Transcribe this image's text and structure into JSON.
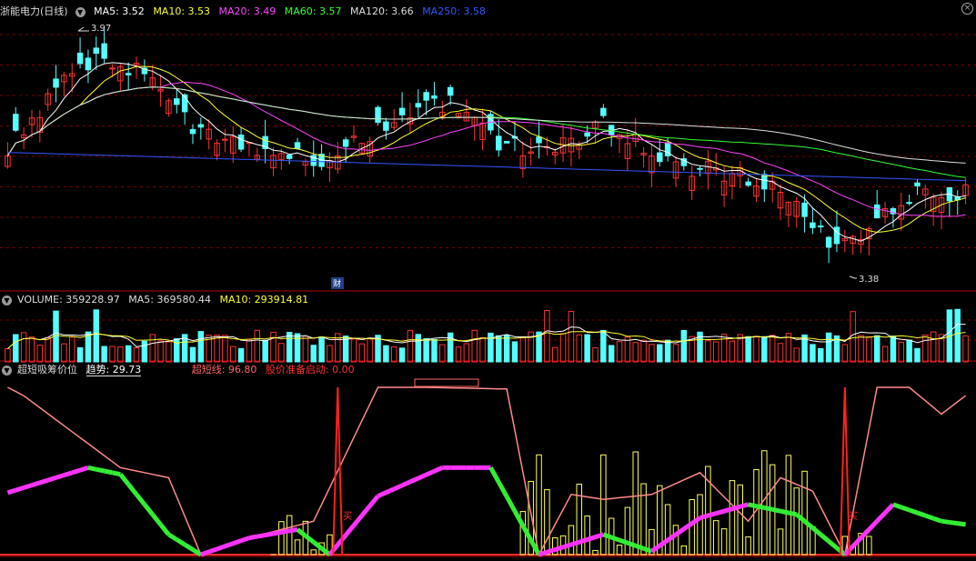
{
  "price_panel": {
    "stock_name": "浙能电力",
    "period": "(日线)",
    "ma_labels": [
      {
        "text": "MA5: 3.52",
        "color": "#ffffff"
      },
      {
        "text": "MA10: 3.53",
        "color": "#ffff33"
      },
      {
        "text": "MA20: 3.49",
        "color": "#ff44ff"
      },
      {
        "text": "MA60: 3.57",
        "color": "#33ff33"
      },
      {
        "text": "MA120: 3.66",
        "color": "#dddddd"
      },
      {
        "text": "MA250: 3.58",
        "color": "#3355ff"
      }
    ],
    "high_marker": "3.97",
    "low_marker": "3.38",
    "finance_badge": "财"
  },
  "volume_panel": {
    "title": "VOLUME: 359228.97",
    "ma5": "MA5: 369580.44",
    "ma10": "MA10: 293914.81"
  },
  "indicator_panel": {
    "name": "超短吸筹价位",
    "trend_label": "趋势: 29.73",
    "line_label": "超短线: 96.80",
    "alert_label": "股价准备启动: 0.00",
    "buy_labels": [
      "买",
      "买"
    ]
  },
  "colors": {
    "up": "#ff3232",
    "down": "#54ffff",
    "ma5": "#ffffff",
    "ma10": "#ffff33",
    "ma20": "#ff44ff",
    "ma60": "#33ff33",
    "ma120": "#dddddd",
    "ma250": "#3355ff",
    "grid": "#7a0000"
  },
  "chart_data": [
    {
      "type": "candlestick",
      "title": "浙能电力 (日线)",
      "price_markers": {
        "high": 3.97,
        "low": 3.38
      },
      "y_range": [
        3.3,
        4.05
      ],
      "bars": 120,
      "price_path_anchors": [
        [
          0,
          3.68
        ],
        [
          8,
          3.9
        ],
        [
          12,
          3.94
        ],
        [
          18,
          3.88
        ],
        [
          22,
          3.75
        ],
        [
          27,
          3.68
        ],
        [
          33,
          3.66
        ],
        [
          39,
          3.64
        ],
        [
          44,
          3.7
        ],
        [
          50,
          3.78
        ],
        [
          55,
          3.8
        ],
        [
          61,
          3.68
        ],
        [
          68,
          3.66
        ],
        [
          74,
          3.74
        ],
        [
          79,
          3.67
        ],
        [
          84,
          3.62
        ],
        [
          90,
          3.6
        ],
        [
          96,
          3.54
        ],
        [
          100,
          3.44
        ],
        [
          103,
          3.38
        ],
        [
          107,
          3.45
        ],
        [
          112,
          3.53
        ],
        [
          119,
          3.55
        ]
      ],
      "series": [
        {
          "name": "MA5",
          "value": 3.52
        },
        {
          "name": "MA10",
          "value": 3.53
        },
        {
          "name": "MA20",
          "value": 3.49
        },
        {
          "name": "MA60",
          "value": 3.57
        },
        {
          "name": "MA120",
          "value": 3.66
        },
        {
          "name": "MA250",
          "value": 3.58
        }
      ]
    },
    {
      "type": "bar",
      "title": "VOLUME",
      "series": [
        {
          "name": "VOLUME",
          "value": 359228.97
        },
        {
          "name": "MA5",
          "value": 369580.44
        },
        {
          "name": "MA10",
          "value": 293914.81
        }
      ]
    },
    {
      "type": "line",
      "title": "超短吸筹价位",
      "ylim": [
        0,
        100
      ],
      "series": [
        {
          "name": "趋势",
          "value": 29.73
        },
        {
          "name": "超短线",
          "value": 96.8
        },
        {
          "name": "股价准备启动",
          "value": 0.0
        }
      ],
      "trend_anchors": [
        [
          0,
          37
        ],
        [
          10,
          52
        ],
        [
          14,
          48
        ],
        [
          20,
          12
        ],
        [
          24,
          0
        ],
        [
          30,
          10
        ],
        [
          36,
          15
        ],
        [
          40,
          0
        ],
        [
          46,
          35
        ],
        [
          54,
          52
        ],
        [
          60,
          52
        ],
        [
          66,
          0
        ],
        [
          74,
          12
        ],
        [
          80,
          2
        ],
        [
          86,
          22
        ],
        [
          92,
          30
        ],
        [
          98,
          24
        ],
        [
          104,
          0
        ],
        [
          110,
          30
        ],
        [
          116,
          20
        ],
        [
          119,
          18
        ]
      ],
      "short_line_anchors": [
        [
          0,
          100
        ],
        [
          2,
          95
        ],
        [
          14,
          52
        ],
        [
          20,
          46
        ],
        [
          24,
          0
        ],
        [
          30,
          10
        ],
        [
          38,
          20
        ],
        [
          46,
          100
        ],
        [
          52,
          100
        ],
        [
          62,
          99
        ],
        [
          66,
          0
        ],
        [
          70,
          36
        ],
        [
          74,
          33
        ],
        [
          80,
          36
        ],
        [
          86,
          49
        ],
        [
          92,
          20
        ],
        [
          96,
          46
        ],
        [
          100,
          38
        ],
        [
          104,
          0
        ],
        [
          108,
          100
        ],
        [
          112,
          100
        ],
        [
          116,
          84
        ],
        [
          119,
          95
        ]
      ],
      "spikes_at": [
        41,
        104
      ]
    }
  ]
}
